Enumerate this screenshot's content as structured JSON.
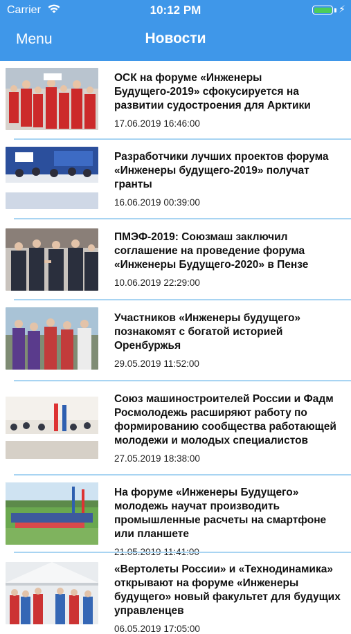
{
  "status_bar": {
    "carrier": "Carrier",
    "time": "10:12 PM",
    "wifi_icon": "wifi-icon",
    "battery_icon": "battery-icon",
    "charging_icon": "charging-bolt-icon",
    "battery_color": "#4ccd5a"
  },
  "nav": {
    "menu_label": "Menu",
    "title": "Новости",
    "background": "#3f97e9"
  },
  "news": [
    {
      "title": "ОСК на форуме «Инженеры Будущего-2019» сфокусируется на развитии судостроения для Арктики",
      "date": "17.06.2019 16:46:00"
    },
    {
      "title": "Разработчики лучших проектов форума «Инженеры будущего-2019» получат гранты",
      "date": "16.06.2019 00:39:00"
    },
    {
      "title": "ПМЭФ-2019: Союзмаш заключил соглашение на проведение форума «Инженеры Будущего-2020» в Пензе",
      "date": "10.06.2019 22:29:00"
    },
    {
      "title": "Участников «Инженеры будущего» познакомят с богатой историей Оренбуржья",
      "date": "29.05.2019 11:52:00"
    },
    {
      "title": "Союз машиностроителей России и Фадм Росмолодежь расширяют работу по формированию сообщества работающей молодежи и молодых специалистов",
      "date": "27.05.2019 18:38:00"
    },
    {
      "title": "На форуме «Инженеры Будущего» молодежь научат производить промышленные расчеты на смартфоне или планшете",
      "date": "21.05.2019 11:41:00"
    },
    {
      "title": "«Вертолеты России» и «Технодинамика» открывают на форуме «Инженеры будущего» новый факультет для будущих управленцев",
      "date": "06.05.2019 17:05:00"
    }
  ]
}
